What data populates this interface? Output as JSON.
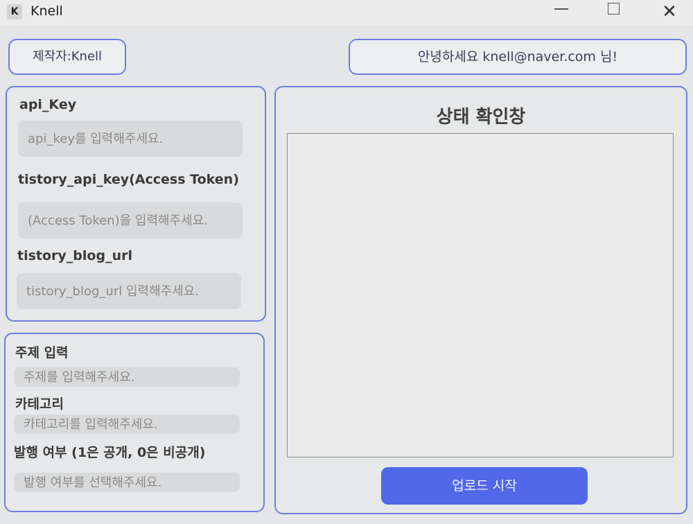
{
  "window": {
    "title": "Knell",
    "icon_letter": "K"
  },
  "header": {
    "author_label": "제작자:Knell",
    "greeting": "안녕하세요 knell@naver.com 님!"
  },
  "api_panel": {
    "api_key_label": "api_Key",
    "api_key_placeholder": "api_key를 입력해주세요.",
    "tistory_key_label": "tistory_api_key(Access Token)",
    "tistory_key_placeholder": "(Access Token)을 입력해주세요.",
    "blog_url_label": "tistory_blog_url",
    "blog_url_placeholder": "tistory_blog_url 입력해주세요."
  },
  "post_panel": {
    "subject_label": "주제 입력",
    "subject_placeholder": "주제를 입력해주세요.",
    "category_label": "카테고리",
    "category_placeholder": "카테고리를 입력해주세요.",
    "publish_label": "발행 여부 (1은 공개, 0은 비공개)",
    "publish_placeholder": "발행 여부를 선택해주세요."
  },
  "status_panel": {
    "title": "상태 확인창",
    "upload_button": "업로드 시작"
  },
  "colors": {
    "accent": "#5168e8",
    "border": "#6d7ee0"
  }
}
